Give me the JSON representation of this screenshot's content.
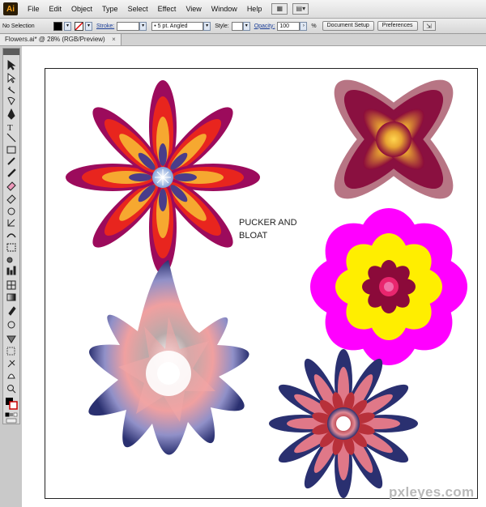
{
  "app": {
    "logo_text": "Ai"
  },
  "menubar": {
    "items": [
      "File",
      "Edit",
      "Object",
      "Type",
      "Select",
      "Effect",
      "View",
      "Window",
      "Help"
    ]
  },
  "controlbar": {
    "selection_label": "No Selection",
    "stroke_label": "Stroke:",
    "brush_value": "5 pt. Angled",
    "style_label": "Style:",
    "opacity_label": "Opacity:",
    "opacity_value": "100",
    "percent": "%",
    "document_setup_label": "Document Setup",
    "preferences_label": "Preferences"
  },
  "document_tab": {
    "title": "Flowers.ai* @ 28% (RGB/Preview)"
  },
  "artboard": {
    "caption": "PUCKER AND\nBLOAT"
  },
  "watermark": "pxleyes.com",
  "colors": {
    "magenta": "#ff00ff",
    "yellow": "#ffee00",
    "dark_red": "#8b0a3a",
    "orange": "#f7a21b",
    "navy": "#2a3070"
  }
}
